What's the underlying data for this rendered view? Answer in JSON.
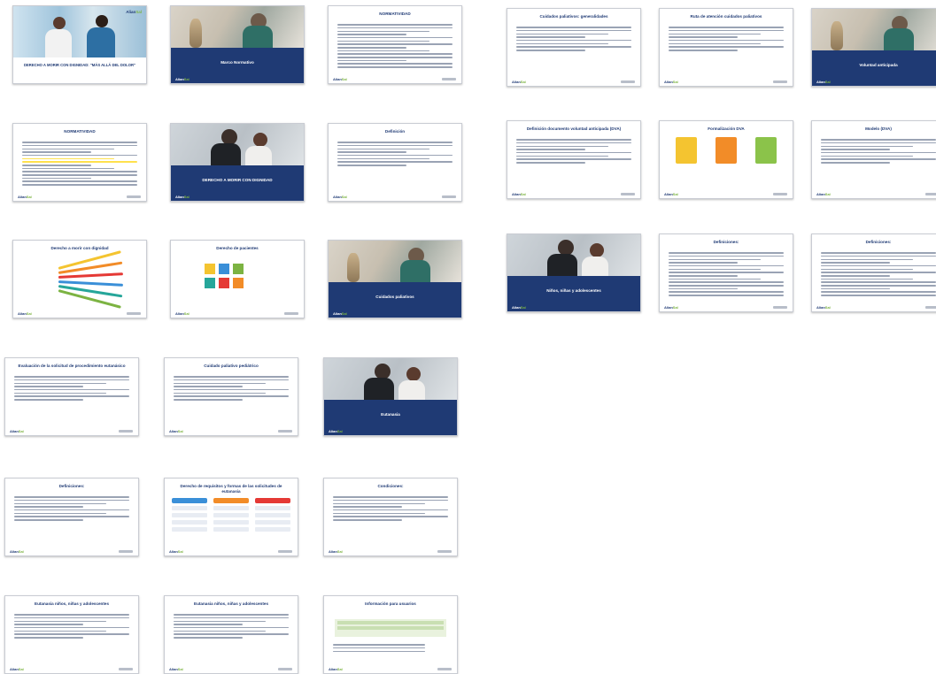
{
  "brand": {
    "logo_prefix": "Alian",
    "logo_suffix": "Sal"
  },
  "slides": [
    {
      "id": "s1",
      "kind": "cover",
      "title": "DERECHO A MORIR CON DIGNIDAD: \"MÁS ALLÁ DEL DOLOR\""
    },
    {
      "id": "s2",
      "kind": "photo_band",
      "title": "Marco Normativo"
    },
    {
      "id": "s3",
      "kind": "text",
      "title": "NORMATIVIDAD"
    },
    {
      "id": "s4",
      "kind": "text",
      "title": "Cuidados paliativos: generalidades"
    },
    {
      "id": "s5",
      "kind": "text",
      "title": "Ruta de atención cuidados paliativos"
    },
    {
      "id": "s6",
      "kind": "photo_band",
      "title": "Voluntad anticipada"
    },
    {
      "id": "s7",
      "kind": "text",
      "title": "NORMATIVIDAD"
    },
    {
      "id": "s8",
      "kind": "couple_band",
      "title": "DERECHO A MORIR CON DIGNIDAD"
    },
    {
      "id": "s9",
      "kind": "text",
      "title": "Definición"
    },
    {
      "id": "s10",
      "kind": "text",
      "title": "Definición documento voluntad anticipada (DVA)"
    },
    {
      "id": "s11",
      "kind": "cards",
      "title": "Formalización DVA"
    },
    {
      "id": "s12",
      "kind": "text",
      "title": "Modelo (DVA)"
    },
    {
      "id": "s13",
      "kind": "fan",
      "title": "Derecho a morir con dignidad"
    },
    {
      "id": "s14",
      "kind": "mosaic",
      "title": "Derecho de pacientes"
    },
    {
      "id": "s15",
      "kind": "photo_band",
      "title": "Cuidados paliativos"
    },
    {
      "id": "s16",
      "kind": "couple_band",
      "title": "Niños, niñas y adolescentes"
    },
    {
      "id": "s17",
      "kind": "text",
      "title": "Definiciones:"
    },
    {
      "id": "s18",
      "kind": "text",
      "title": "Definiciones:"
    },
    {
      "id": "s19",
      "kind": "text",
      "title": "Evaluación de la solicitud de procedimiento eutanásico"
    },
    {
      "id": "s20",
      "kind": "text",
      "title": "Cuidado paliativo pediátrico"
    },
    {
      "id": "s21",
      "kind": "couple_band",
      "title": "Eutanasia"
    },
    {
      "id": "s22",
      "kind": "text",
      "title": "Definiciones:"
    },
    {
      "id": "s23",
      "kind": "flow",
      "title": "Derecho de requisitos y formas de las solicitudes de eutanasia"
    },
    {
      "id": "s24",
      "kind": "text",
      "title": "Condiciones:"
    },
    {
      "id": "s25",
      "kind": "text",
      "title": "Eutanasia niños, niñas y adolescentes"
    },
    {
      "id": "s26",
      "kind": "text",
      "title": "Eutanasia niños, niñas y adolescentes"
    },
    {
      "id": "s27",
      "kind": "table",
      "title": "Información para usuarios"
    }
  ],
  "colors": {
    "navy": "#1f3a74",
    "green": "#7cb342",
    "highlight": "#ffe14d"
  }
}
